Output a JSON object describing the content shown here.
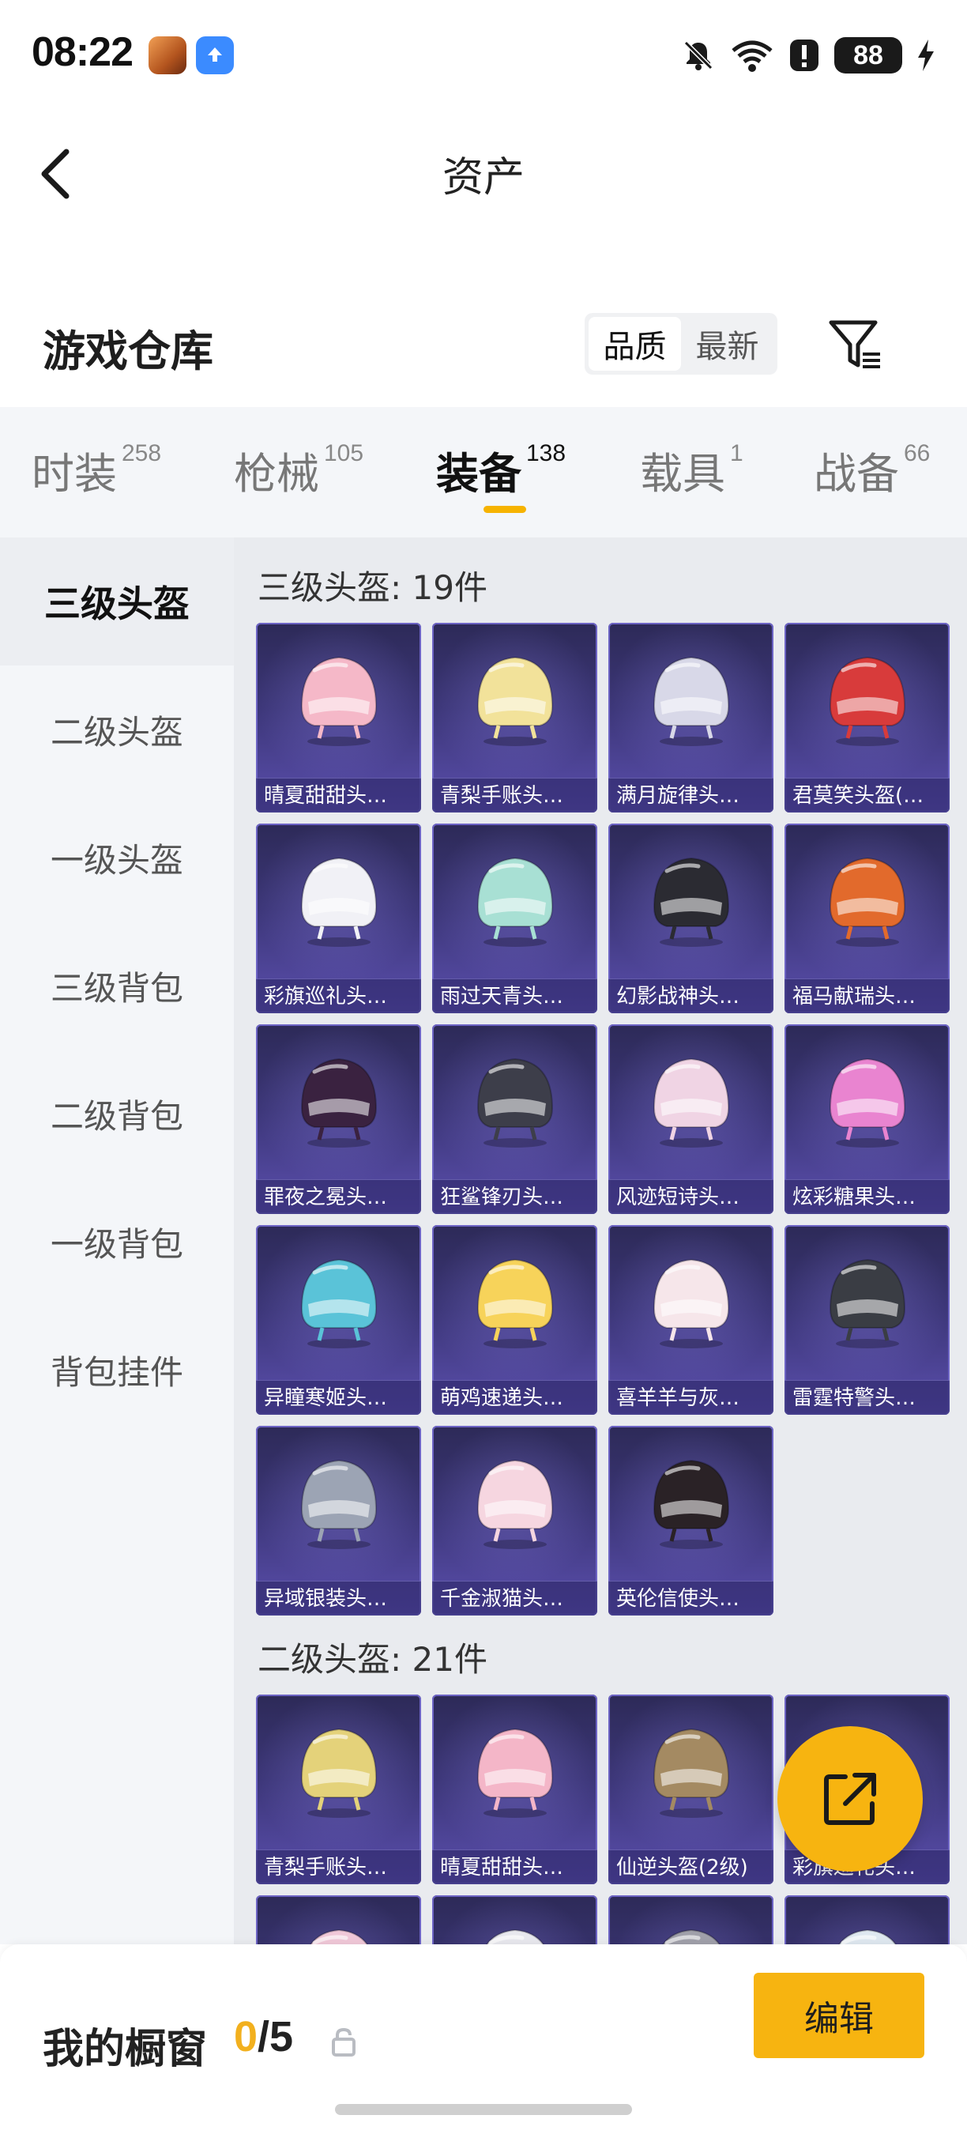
{
  "status_bar": {
    "time": "08:22",
    "battery": "88",
    "icons": [
      "game-app-icon",
      "upload-app-icon",
      "mute-icon",
      "wifi-icon",
      "alert-icon",
      "battery-icon",
      "charging-icon"
    ]
  },
  "header": {
    "title": "资产",
    "back_icon": "chevron-left-icon"
  },
  "warehouse": {
    "title": "游戏仓库",
    "sort_options": [
      "品质",
      "最新"
    ],
    "sort_selected": "品质",
    "filter_icon": "filter-icon"
  },
  "categories": [
    {
      "label": "时装",
      "count": "258"
    },
    {
      "label": "枪械",
      "count": "105"
    },
    {
      "label": "装备",
      "count": "138",
      "active": true
    },
    {
      "label": "载具",
      "count": "1"
    },
    {
      "label": "战备",
      "count": "66"
    }
  ],
  "sidebar": {
    "items": [
      {
        "label": "三级头盔",
        "active": true
      },
      {
        "label": "二级头盔"
      },
      {
        "label": "一级头盔"
      },
      {
        "label": "三级背包"
      },
      {
        "label": "二级背包"
      },
      {
        "label": "一级背包"
      },
      {
        "label": "背包挂件"
      }
    ]
  },
  "sections": [
    {
      "title": "三级头盔: 19件",
      "items": [
        {
          "name": "晴夏甜甜头…",
          "color": "#f5b8c8"
        },
        {
          "name": "青梨手账头…",
          "color": "#f2e29a"
        },
        {
          "name": "满月旋律头…",
          "color": "#d8d8e8"
        },
        {
          "name": "君莫笑头盔(…",
          "color": "#d83b3b"
        },
        {
          "name": "彩旗巡礼头…",
          "color": "#f1f1f6"
        },
        {
          "name": "雨过天青头…",
          "color": "#a8e0d4"
        },
        {
          "name": "幻影战神头…",
          "color": "#2b2b32"
        },
        {
          "name": "福马献瑞头…",
          "color": "#e26a2c"
        },
        {
          "name": "罪夜之冕头…",
          "color": "#3a2240"
        },
        {
          "name": "狂鲨锋刃头…",
          "color": "#3d3e4a"
        },
        {
          "name": "风迹短诗头…",
          "color": "#f0d4e4"
        },
        {
          "name": "炫彩糖果头…",
          "color": "#e984d0"
        },
        {
          "name": "异瞳寒姬头…",
          "color": "#5ac3d8"
        },
        {
          "name": "萌鸡速递头…",
          "color": "#f7d35a"
        },
        {
          "name": "喜羊羊与灰…",
          "color": "#f6e6ea"
        },
        {
          "name": "雷霆特警头…",
          "color": "#3a3d44"
        },
        {
          "name": "异域银装头…",
          "color": "#9ca4b4"
        },
        {
          "name": "千金淑猫头…",
          "color": "#f6d6e0"
        },
        {
          "name": "英伦信使头…",
          "color": "#2a2226"
        }
      ]
    },
    {
      "title": "二级头盔: 21件",
      "items": [
        {
          "name": "青梨手账头…",
          "color": "#e4d27a"
        },
        {
          "name": "晴夏甜甜头…",
          "color": "#f4b6c8"
        },
        {
          "name": "仙逆头盔(2级)",
          "color": "#a48a62"
        },
        {
          "name": "彩旗巡礼头…",
          "color": "#efeff4"
        },
        {
          "name": "",
          "color": "#f0c8d8"
        },
        {
          "name": "",
          "color": "#e8e8ee"
        },
        {
          "name": "",
          "color": "#a0a0aa"
        },
        {
          "name": "",
          "color": "#dfe8f0"
        }
      ]
    }
  ],
  "showcase": {
    "label": "我的橱窗",
    "current": "0",
    "max": "/5",
    "lock_icon": "lock-icon",
    "edit_label": "编辑"
  },
  "fab_icon": "share-icon"
}
